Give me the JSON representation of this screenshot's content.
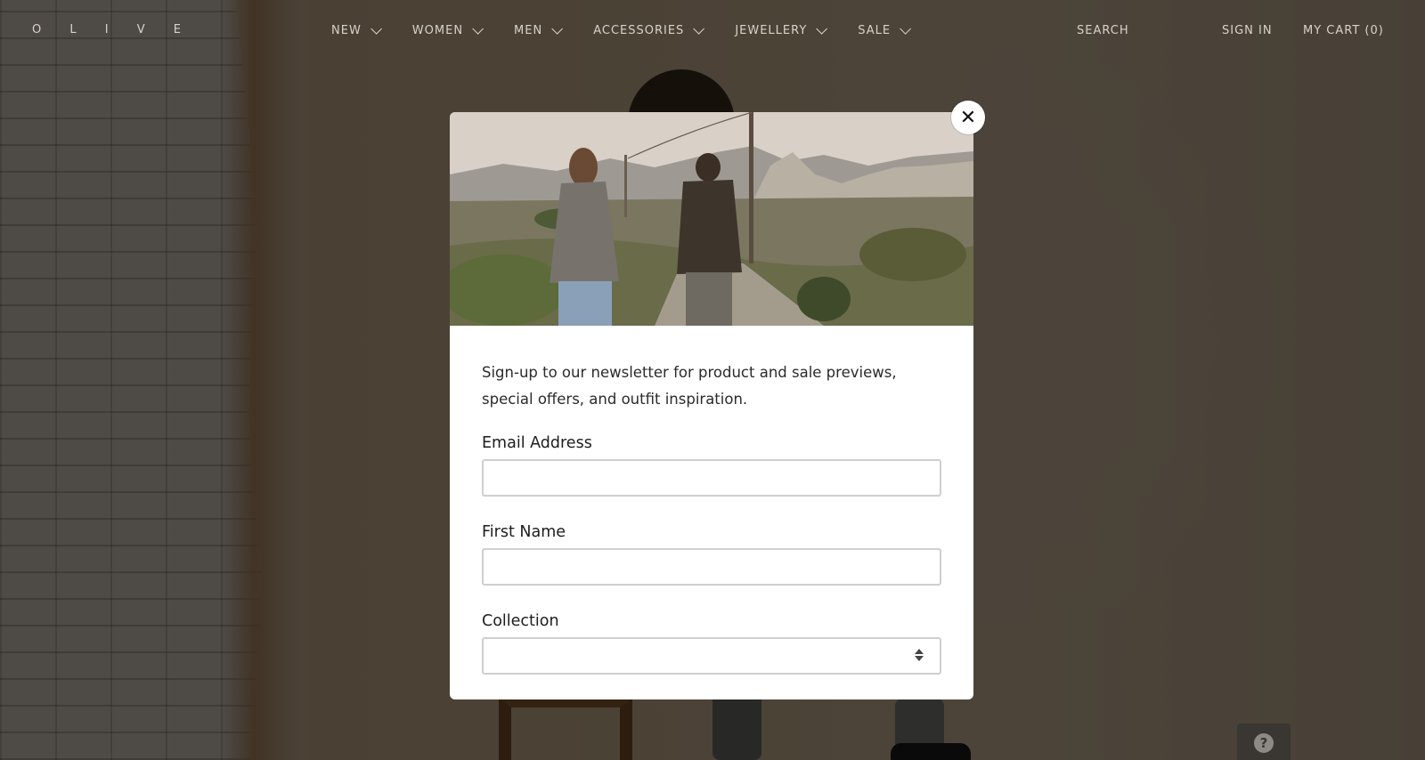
{
  "header": {
    "logo": "O L I V E",
    "nav": [
      {
        "label": "NEW"
      },
      {
        "label": "WOMEN"
      },
      {
        "label": "MEN"
      },
      {
        "label": "ACCESSORIES"
      },
      {
        "label": "JEWELLERY"
      },
      {
        "label": "SALE"
      }
    ],
    "search_label": "SEARCH",
    "signin_label": "SIGN IN",
    "cart_label": "MY CART (0)"
  },
  "modal": {
    "close_symbol": "✕",
    "intro": "Sign-up to our newsletter for product and sale previews, special offers, and outfit inspiration.",
    "email_label": "Email Address",
    "email_value": "",
    "first_name_label": "First Name",
    "first_name_value": "",
    "collection_label": "Collection",
    "collection_selected": ""
  },
  "help_widget": {
    "icon_symbol": "?"
  },
  "icons": {
    "close": "close-icon",
    "chevron": "chevron-down-icon",
    "select": "select-arrows-icon",
    "help": "help-icon"
  }
}
